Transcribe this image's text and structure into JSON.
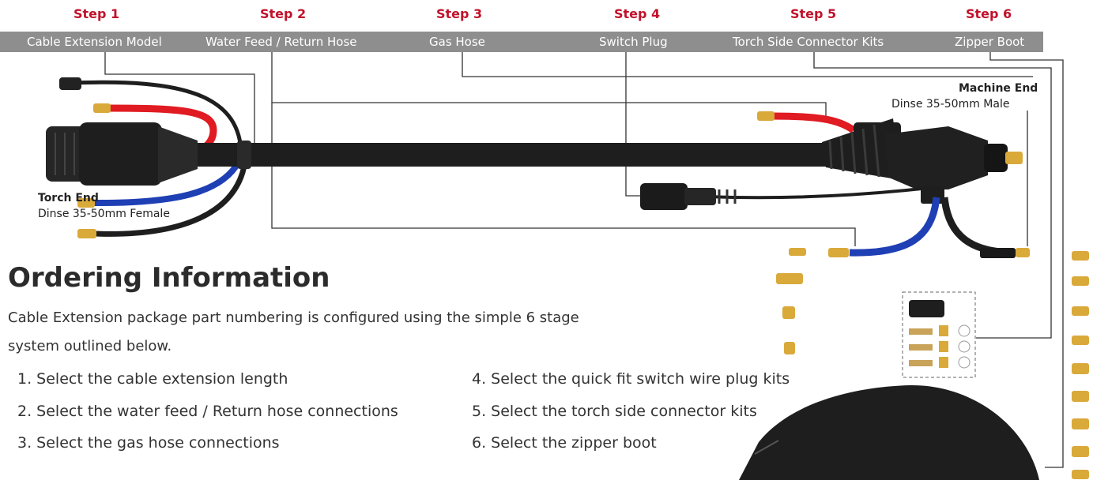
{
  "steps": [
    {
      "number": "Step 1",
      "label": "Cable Extension Model"
    },
    {
      "number": "Step 2",
      "label": "Water Feed / Return Hose"
    },
    {
      "number": "Step 3",
      "label": "Gas Hose"
    },
    {
      "number": "Step 4",
      "label": "Switch Plug"
    },
    {
      "number": "Step 5",
      "label": "Torch Side Connector Kits"
    },
    {
      "number": "Step 6",
      "label": "Zipper Boot"
    }
  ],
  "machine_end": {
    "title": "Machine End",
    "subtitle": "Dinse 35-50mm Male"
  },
  "torch_end": {
    "title": "Torch End",
    "subtitle": "Dinse 35-50mm Female"
  },
  "ordering": {
    "heading": "Ordering Information",
    "description_line1": "Cable Extension package part numbering is configured using the simple 6 stage",
    "description_line2": "system outlined below.",
    "items": [
      "1. Select the cable extension length",
      "2. Select the water feed / Return hose connections",
      "3. Select the gas hose connections",
      "4. Select the quick fit switch wire plug kits",
      "5. Select the torch side connector kits",
      "6. Select the zipper boot"
    ]
  },
  "colors": {
    "accent": "#c0122b",
    "bar": "#8e8e8e",
    "cable": "#1e1e1e",
    "red_hose": "#e01b22",
    "blue_hose": "#1f3fb4",
    "brass": "#d9a93a"
  }
}
